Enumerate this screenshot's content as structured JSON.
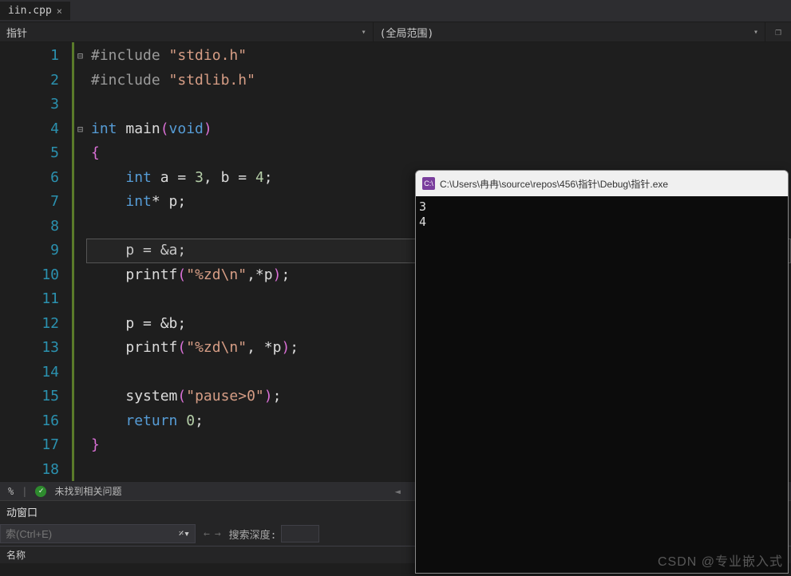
{
  "tab": {
    "name": "iin.cpp",
    "close_glyph": "×"
  },
  "context": {
    "left": "指针",
    "right": "(全局范围)"
  },
  "gutter": [
    "1",
    "2",
    "3",
    "4",
    "5",
    "6",
    "7",
    "8",
    "9",
    "10",
    "11",
    "12",
    "13",
    "14",
    "15",
    "16",
    "17",
    "18"
  ],
  "folds": [
    "⊟",
    "",
    "",
    "⊟",
    "",
    "",
    "",
    "",
    "",
    "",
    "",
    "",
    "",
    "",
    "",
    "",
    "",
    ""
  ],
  "code": {
    "l1_pp": "#include ",
    "l1_str": "\"stdio.h\"",
    "l2_pp": "#include ",
    "l2_str": "\"stdlib.h\"",
    "l4_kw1": "int",
    "l4_fn": " main",
    "l4_br1": "(",
    "l4_kw2": "void",
    "l4_br2": ")",
    "l5_br": "{",
    "l6_pre": "    ",
    "l6_kw": "int",
    "l6_rest": " a = ",
    "l6_n1": "3",
    "l6_m": ", b = ",
    "l6_n2": "4",
    "l6_end": ";",
    "l7_pre": "    ",
    "l7_kw": "int",
    "l7_rest": "* p;",
    "l9_pre": "    ",
    "l9_rest": "p = &a;",
    "l10_pre": "    ",
    "l10_fn": "printf",
    "l10_br1": "(",
    "l10_str": "\"%zd\\n\"",
    "l10_mid": ",*p",
    "l10_br2": ")",
    "l10_end": ";",
    "l12_pre": "    ",
    "l12_rest": "p = &b;",
    "l13_pre": "    ",
    "l13_fn": "printf",
    "l13_br1": "(",
    "l13_str": "\"%zd\\n\"",
    "l13_mid": ", *p",
    "l13_br2": ")",
    "l13_end": ";",
    "l15_pre": "    ",
    "l15_fn": "system",
    "l15_br1": "(",
    "l15_str": "\"pause>0\"",
    "l15_br2": ")",
    "l15_end": ";",
    "l16_pre": "    ",
    "l16_kw": "return",
    "l16_sp": " ",
    "l16_n": "0",
    "l16_end": ";",
    "l17_br": "}"
  },
  "issues": {
    "percent": "%",
    "text": "未找到相关问题",
    "check": "✓",
    "left": "◄",
    "divider": "|"
  },
  "panel": {
    "title": "动窗口",
    "search_placeholder": "索(Ctrl+E)",
    "search_icon": "🔎",
    "arrow_left": "←",
    "arrow_right": "→",
    "depth_label": "搜索深度:",
    "header": "名称"
  },
  "console": {
    "icon_text": "C:\\",
    "title": "C:\\Users\\冉冉\\source\\repos\\456\\指针\\Debug\\指针.exe",
    "output": "3\n4"
  },
  "watermark": "CSDN @专业嵌入式",
  "icons": {
    "dropdown": "▾",
    "cube": "❐"
  }
}
